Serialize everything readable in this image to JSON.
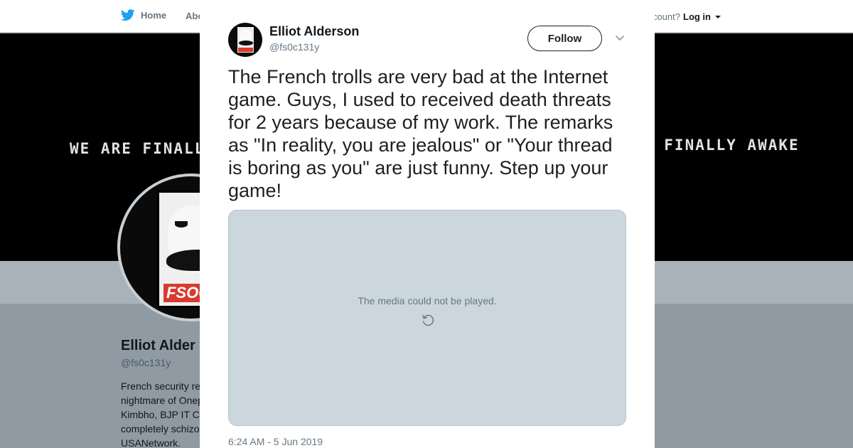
{
  "nav": {
    "home_label": "Home",
    "about_label": "Abo",
    "account_text": "ccount?",
    "login_label": "Log in"
  },
  "banner": {
    "left_text": "WE ARE FINALLY",
    "right_text": "E FINALLY AWAKE"
  },
  "profile": {
    "avatar_tag": "FSOCI",
    "name": "Elliot Alder",
    "handle": "@fs0c131y",
    "bio_lines": [
      "French security re",
      "nightmare of Onep",
      "Kimbho, BJP IT C",
      "completely schizo",
      "USANetwork."
    ]
  },
  "tweet": {
    "author_name": "Elliot Alderson",
    "author_handle": "@fs0c131y",
    "follow_label": "Follow",
    "text": "The French trolls are very bad at the Internet game. Guys, I used to received death threats for 2 years because of my work. The remarks as \"In reality, you are jealous\" or \"Your thread is boring as you\" are just funny. Step up your game!",
    "media_error": "The media could not be played.",
    "timestamp": "6:24 AM - 5 Jun 2019"
  },
  "colors": {
    "twitter_blue": "#1da1f2",
    "overlay": "#8f9aa3",
    "media_bg": "#ccd6dd",
    "text_primary": "#1c2022",
    "text_secondary": "#657786",
    "fsociety_red": "#d83b2e"
  },
  "icons": {
    "nav_home": "twitter-bird-icon",
    "close": "close-icon",
    "tweet_menu": "chevron-down-icon",
    "media_retry": "retry-icon"
  }
}
